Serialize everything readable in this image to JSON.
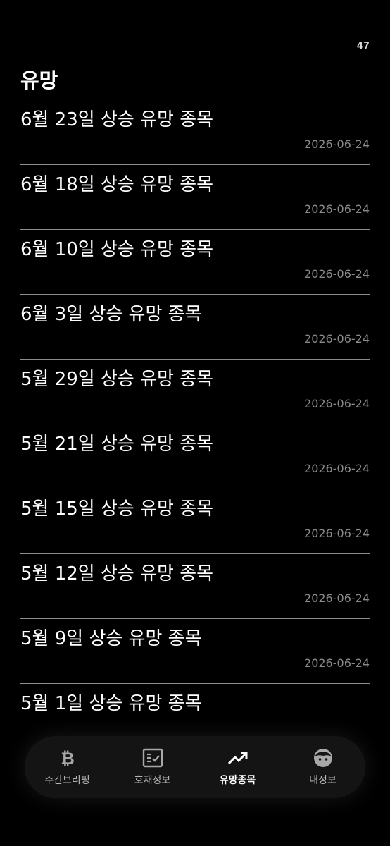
{
  "status": {
    "number": "47"
  },
  "header": {
    "title": "유망"
  },
  "items": [
    {
      "title": "6월 23일 상승 유망 종목",
      "date": "2026-06-24"
    },
    {
      "title": "6월 18일 상승 유망 종목",
      "date": "2026-06-24"
    },
    {
      "title": "6월 10일 상승 유망 종목",
      "date": "2026-06-24"
    },
    {
      "title": "6월 3일 상승 유망 종목",
      "date": "2026-06-24"
    },
    {
      "title": "5월 29일 상승 유망 종목",
      "date": "2026-06-24"
    },
    {
      "title": "5월 21일 상승 유망 종목",
      "date": "2026-06-24"
    },
    {
      "title": "5월 15일 상승 유망 종목",
      "date": "2026-06-24"
    },
    {
      "title": "5월 12일 상승 유망 종목",
      "date": "2026-06-24"
    },
    {
      "title": "5월 9일 상승 유망 종목",
      "date": "2026-06-24"
    },
    {
      "title": "5월 1일 상승 유망 종목",
      "date": ""
    }
  ],
  "nav": {
    "items": [
      {
        "label": "주간브리핑",
        "icon": "bitcoin-icon",
        "active": false
      },
      {
        "label": "호재정보",
        "icon": "checklist-icon",
        "active": false
      },
      {
        "label": "유망종목",
        "icon": "trending-up-icon",
        "active": true
      },
      {
        "label": "내정보",
        "icon": "face-icon",
        "active": false
      }
    ]
  },
  "colors": {
    "background": "#000000",
    "text": "#ffffff",
    "muted": "#8a8a8a",
    "divider": "#8c8c8c",
    "nav_bg": "#141414"
  }
}
